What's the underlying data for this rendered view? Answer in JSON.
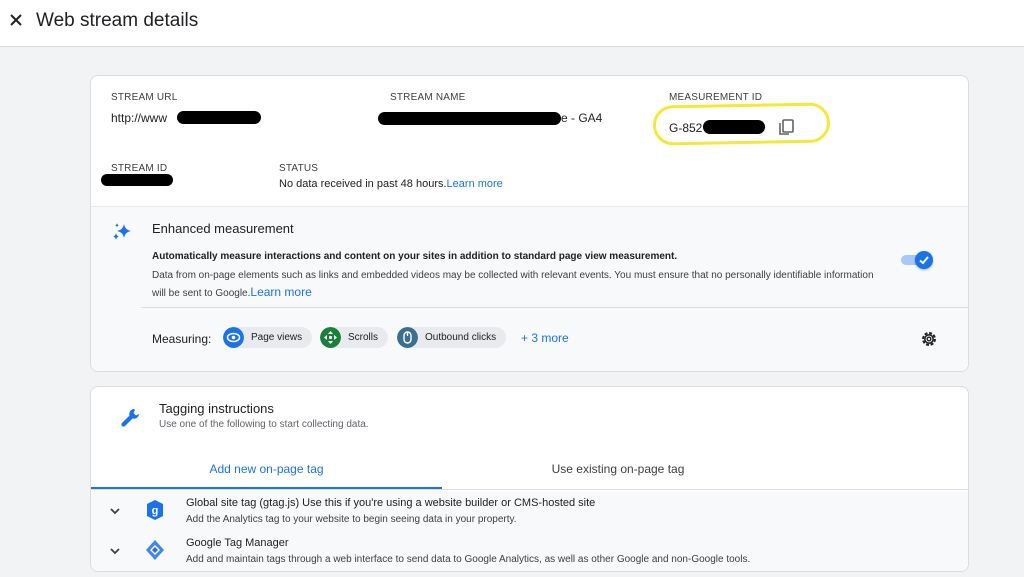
{
  "header": {
    "title": "Web stream details",
    "close_icon": "close-icon"
  },
  "stream": {
    "url_label": "STREAM URL",
    "url_value": "http://www",
    "name_label": "STREAM NAME",
    "name_value": "e - GA4",
    "measurement_label": "MEASUREMENT ID",
    "measurement_value": "G-852",
    "id_label": "STREAM ID",
    "status_label": "STATUS",
    "status_text": "No data received in past 48 hours.",
    "status_link": "Learn more"
  },
  "enhanced": {
    "title": "Enhanced measurement",
    "description_bold": "Automatically measure interactions and content on your sites in addition to standard page view measurement.",
    "description": "Data from on-page elements such as links and embedded videos may be collected with relevant events. You must ensure that no personally identifiable information will be sent to Google.",
    "link": "Learn more",
    "toggle_on": true,
    "measuring_label": "Measuring:",
    "chips": [
      {
        "label": "Page views",
        "color": "#1a73e8"
      },
      {
        "label": "Scrolls",
        "color": "#188038"
      },
      {
        "label": "Outbound clicks",
        "color": "#3c6e8f"
      }
    ],
    "more": "+ 3 more"
  },
  "tagging": {
    "title": "Tagging instructions",
    "subtitle": "Use one of the following to start collecting data.",
    "tabs": [
      {
        "label": "Add new on-page tag",
        "active": true
      },
      {
        "label": "Use existing on-page tag",
        "active": false
      }
    ],
    "rows": [
      {
        "title": "Global site tag (gtag.js) Use this if you're using a website builder or CMS-hosted site",
        "description": "Add the Analytics tag to your website to begin seeing data in your property."
      },
      {
        "title": "Google Tag Manager",
        "description": "Add and maintain tags through a web interface to send data to Google Analytics, as well as other Google and non-Google tools."
      }
    ]
  },
  "colors": {
    "accent": "#1a73e8",
    "highlight": "#f5e83a"
  }
}
